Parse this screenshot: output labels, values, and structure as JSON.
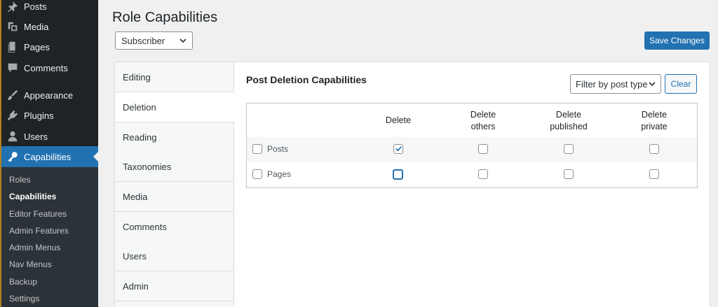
{
  "sidebar": {
    "items": [
      {
        "label": "Posts",
        "icon": "pushpin-icon"
      },
      {
        "label": "Media",
        "icon": "media-icon"
      },
      {
        "label": "Pages",
        "icon": "pages-icon"
      },
      {
        "label": "Comments",
        "icon": "comment-icon"
      },
      {
        "label": "Appearance",
        "icon": "paintbrush-icon"
      },
      {
        "label": "Plugins",
        "icon": "plugin-icon"
      },
      {
        "label": "Users",
        "icon": "user-icon"
      },
      {
        "label": "Capabilities",
        "icon": "key-icon",
        "active": true
      }
    ],
    "submenu": [
      "Roles",
      "Capabilities",
      "Editor Features",
      "Admin Features",
      "Admin Menus",
      "Nav Menus",
      "Backup",
      "Settings"
    ]
  },
  "header": {
    "title": "Role Capabilities",
    "role_selected": "Subscriber",
    "save_label": "Save Changes"
  },
  "tabs": [
    "Editing",
    "Deletion",
    "Reading",
    "Taxonomies",
    "Media",
    "Comments",
    "Users",
    "Admin"
  ],
  "active_tab": "Deletion",
  "panel": {
    "title": "Post Deletion Capabilities",
    "filter_label": "Filter by post type",
    "clear_label": "Clear",
    "columns": [
      "Delete",
      "Delete\nothers",
      "Delete\npublished",
      "Delete\nprivate"
    ],
    "rows": [
      {
        "label": "Posts",
        "row_checked": false,
        "values": [
          true,
          false,
          false,
          false
        ]
      },
      {
        "label": "Pages",
        "row_checked": false,
        "values": [
          false,
          false,
          false,
          false
        ]
      }
    ]
  },
  "colors": {
    "sidebar_bg": "#1d2327",
    "accent": "#2271b1",
    "page_bg": "#f0f0f1"
  }
}
